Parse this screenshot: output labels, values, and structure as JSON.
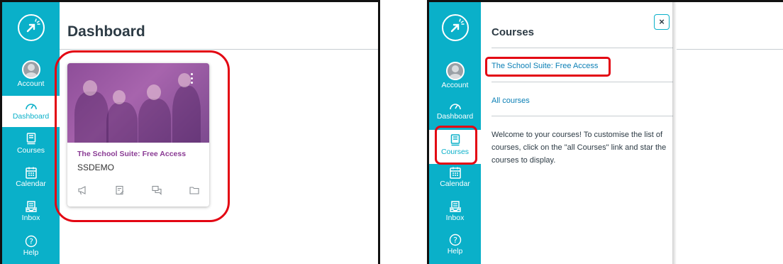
{
  "nav": {
    "account": "Account",
    "dashboard": "Dashboard",
    "courses": "Courses",
    "calendar": "Calendar",
    "inbox": "Inbox",
    "help": "Help"
  },
  "left": {
    "title": "Dashboard",
    "card": {
      "title": "The School Suite: Free Access",
      "code": "SSDEMO",
      "icons": [
        "megaphone-icon",
        "assignment-icon",
        "discussion-icon",
        "folder-icon"
      ]
    }
  },
  "right": {
    "tray_title": "Courses",
    "course_link": "The School Suite: Free Access",
    "all_courses": "All courses",
    "welcome": "Welcome to your courses! To customise the list of courses, click on the \"all Courses\" link and star the courses to display.",
    "close": "×"
  },
  "colors": {
    "nav": "#0ab0c9",
    "highlight": "#e30613",
    "link": "#0a7fb5",
    "course_title": "#8a3b94"
  }
}
